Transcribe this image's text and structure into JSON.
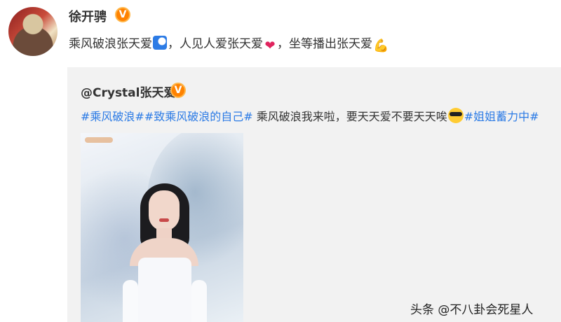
{
  "post": {
    "username": "徐开骋",
    "verified_mark": "V",
    "text_1": "乘风破浪张天爱",
    "text_2": "，人见人爱张天爱",
    "text_3": "，坐等播出张天爱",
    "heart_glyph": "❤",
    "muscle_glyph": "💪"
  },
  "repost": {
    "username": "@Crystal张天爱",
    "verified_mark": "V",
    "tag_1": "#乘风破浪#",
    "tag_2": "#致乘风破浪的自己#",
    "body": " 乘风破浪我来啦，要天天爱不要天天唉",
    "tag_3": "#姐姐蓄力中#"
  },
  "watermark": "头条 @不八卦会死星人",
  "colors": {
    "link": "#2c7be5",
    "verified": "#ff8200",
    "repost_bg": "#f2f2f2"
  },
  "icons": [
    "avatar-image",
    "verified-icon",
    "wave-emoji-icon",
    "heart-emoji-icon",
    "muscle-emoji-icon",
    "cool-emoji-icon"
  ]
}
